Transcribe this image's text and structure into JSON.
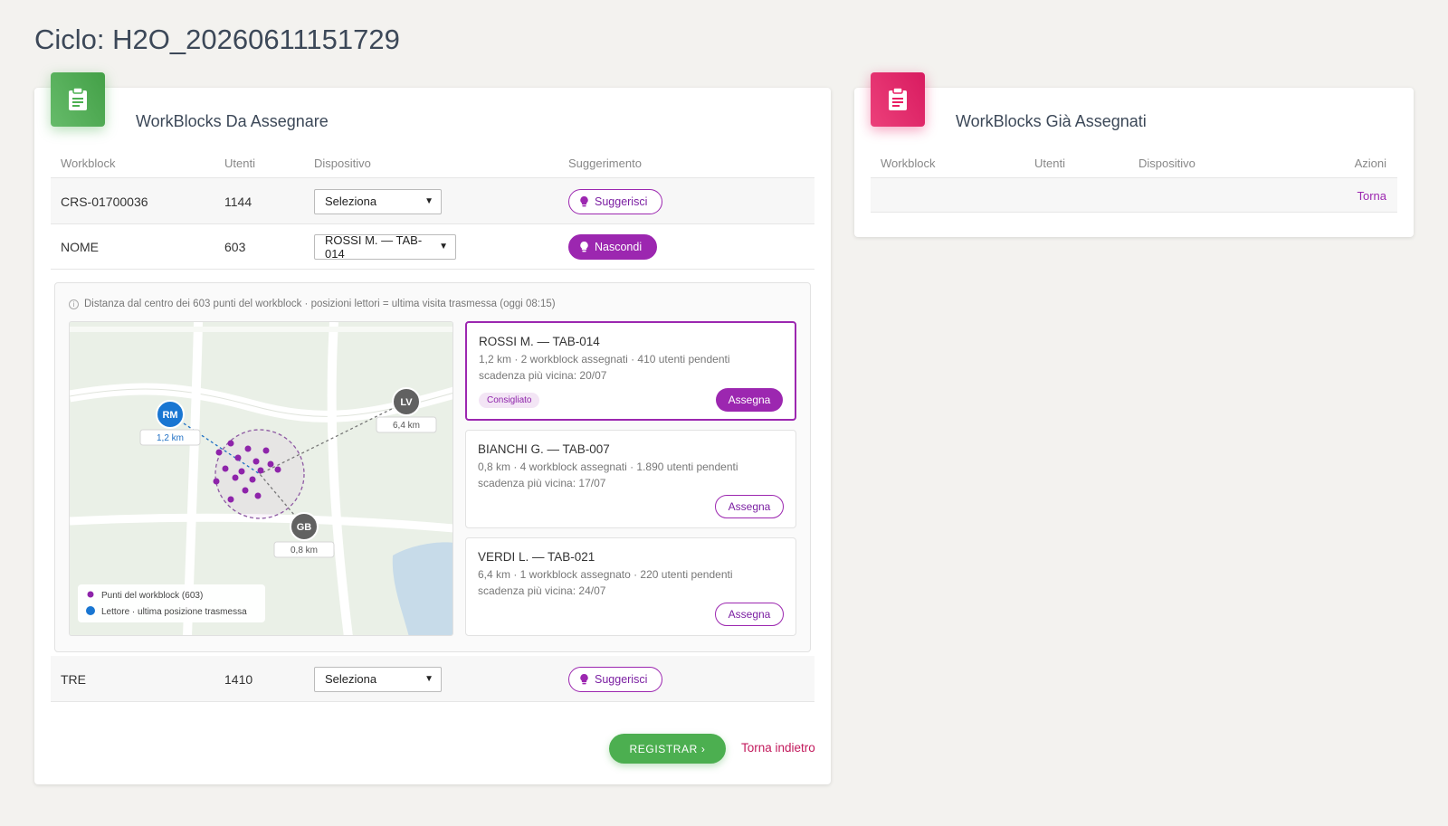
{
  "page": {
    "title": "Ciclo: H2O_20260611151729"
  },
  "unassigned": {
    "title": "WorkBlocks Da Assegnare",
    "icon": "clipboard-icon",
    "columns": {
      "workblock": "Workblock",
      "utenti": "Utenti",
      "dispositivo": "Dispositivo",
      "suggerimento": "Suggerimento"
    },
    "rows": [
      {
        "workblock": "CRS-01700036",
        "utenti": "1144",
        "device": "Seleziona",
        "action": "Suggerisci"
      },
      {
        "workblock": "NOME",
        "utenti": "603",
        "device": "ROSSI M. — TAB-014",
        "action": "Nascondi"
      },
      {
        "workblock": "TRE",
        "utenti": "1410",
        "device": "Seleziona",
        "action": "Suggerisci"
      }
    ],
    "suggestion_panel": {
      "info": "Distanza dal centro dei 603 punti del workblock · posizioni lettori = ultima visita trasmessa (oggi 08:15)",
      "map": {
        "readers": [
          {
            "initials": "RM",
            "distance": "1,2 km",
            "color": "#1976d2"
          },
          {
            "initials": "LV",
            "distance": "6,4 km",
            "color": "#616161"
          },
          {
            "initials": "GB",
            "distance": "0,8 km",
            "color": "#616161"
          }
        ],
        "legend": {
          "points": "Punti del workblock (603)",
          "readers": "Lettore · ultima posizione trasmessa"
        }
      },
      "candidates": [
        {
          "name": "ROSSI M. — TAB-014",
          "line1": "1,2 km · 2 workblock assegnati · 410 utenti pendenti",
          "line2": "scadenza più vicina: 20/07",
          "tag": "Consigliato",
          "action": "Assegna"
        },
        {
          "name": "BIANCHI G. — TAB-007",
          "line1": "0,8 km · 4 workblock assegnati · 1.890 utenti pendenti",
          "line2": "scadenza più vicina: 17/07",
          "action": "Assegna"
        },
        {
          "name": "VERDI L. — TAB-021",
          "line1": "6,4 km · 1 workblock assegnato · 220 utenti pendenti",
          "line2": "scadenza più vicina: 24/07",
          "action": "Assegna"
        }
      ]
    },
    "register_label": "REGISTRAR ›",
    "back_label": "Torna indietro"
  },
  "assigned": {
    "title": "WorkBlocks Già Assegnati",
    "icon": "clipboard-icon",
    "columns": {
      "workblock": "Workblock",
      "utenti": "Utenti",
      "dispositivo": "Dispositivo",
      "azioni": "Azioni"
    },
    "row_action": "Torna"
  },
  "colors": {
    "accent": "#9c27b0",
    "success": "#4caf50",
    "pink": "#e91e63",
    "reader_active": "#1976d2"
  }
}
